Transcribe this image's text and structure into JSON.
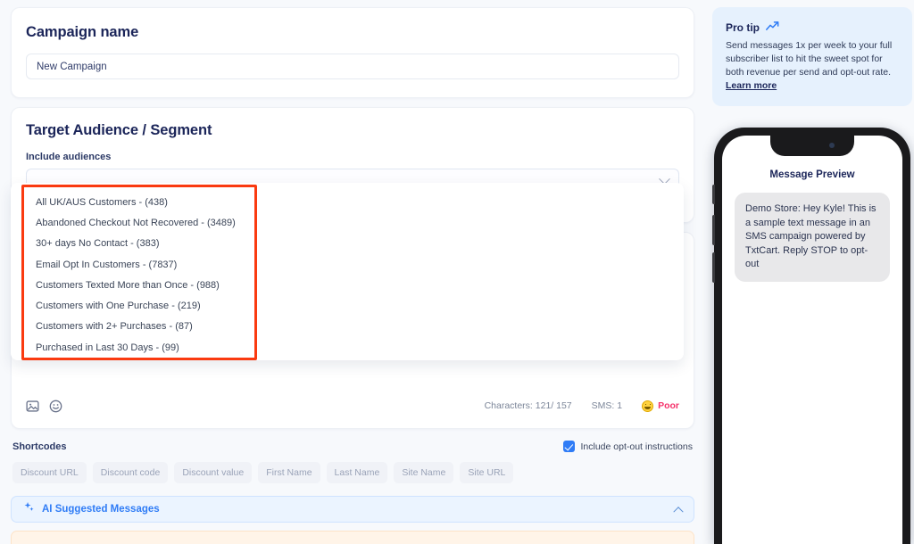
{
  "campaign": {
    "card_title": "Campaign name",
    "input_value": "New Campaign",
    "input_placeholder": "Campaign name"
  },
  "audience": {
    "card_title": "Target Audience / Segment",
    "field_label": "Include audiences",
    "select_value": "",
    "select_placeholder": "",
    "chevron_icon": "chevron-down-icon",
    "options": [
      "All UK/AUS Customers - (438)",
      "Abandoned Checkout Not Recovered - (3489)",
      "30+ days No Contact - (383)",
      "Email Opt In Customers - (7837)",
      "Customers Texted More than Once - (988)",
      "Customers with One Purchase - (219)",
      "Customers with 2+ Purchases - (87)",
      "Purchased in Last 30 Days - (99)"
    ]
  },
  "composer": {
    "image_icon": "image-icon",
    "emoji_icon": "emoji-icon",
    "characters_label": "Characters: 121/ 157",
    "sms_label": "SMS: 1",
    "quality_label": "Poor",
    "quality_icon": "grimacing-face-icon",
    "quality_color": "#f5316a"
  },
  "shortcodes": {
    "label": "Shortcodes",
    "optout_label": "Include opt-out instructions",
    "optout_checked": true,
    "chips": [
      "Discount URL",
      "Discount code",
      "Discount value",
      "First Name",
      "Last Name",
      "Site Name",
      "Site URL"
    ]
  },
  "ai_panel": {
    "label": "AI Suggested Messages",
    "sparkle_icon": "sparkle-icon",
    "collapse_icon": "chevron-up-icon",
    "accent_color": "#2f7cf6"
  },
  "pro_tip": {
    "title": "Pro tip",
    "icon": "trending-up-icon",
    "body": "Send messages 1x per week to your full subscriber list to hit the sweet spot for both revenue per send and opt-out rate. ",
    "link_label": "Learn more"
  },
  "phone_preview": {
    "title": "Message Preview",
    "message": "Demo Store: Hey Kyle! This is a sample text message in an SMS campaign powered by TxtCart. Reply STOP to opt-out"
  }
}
